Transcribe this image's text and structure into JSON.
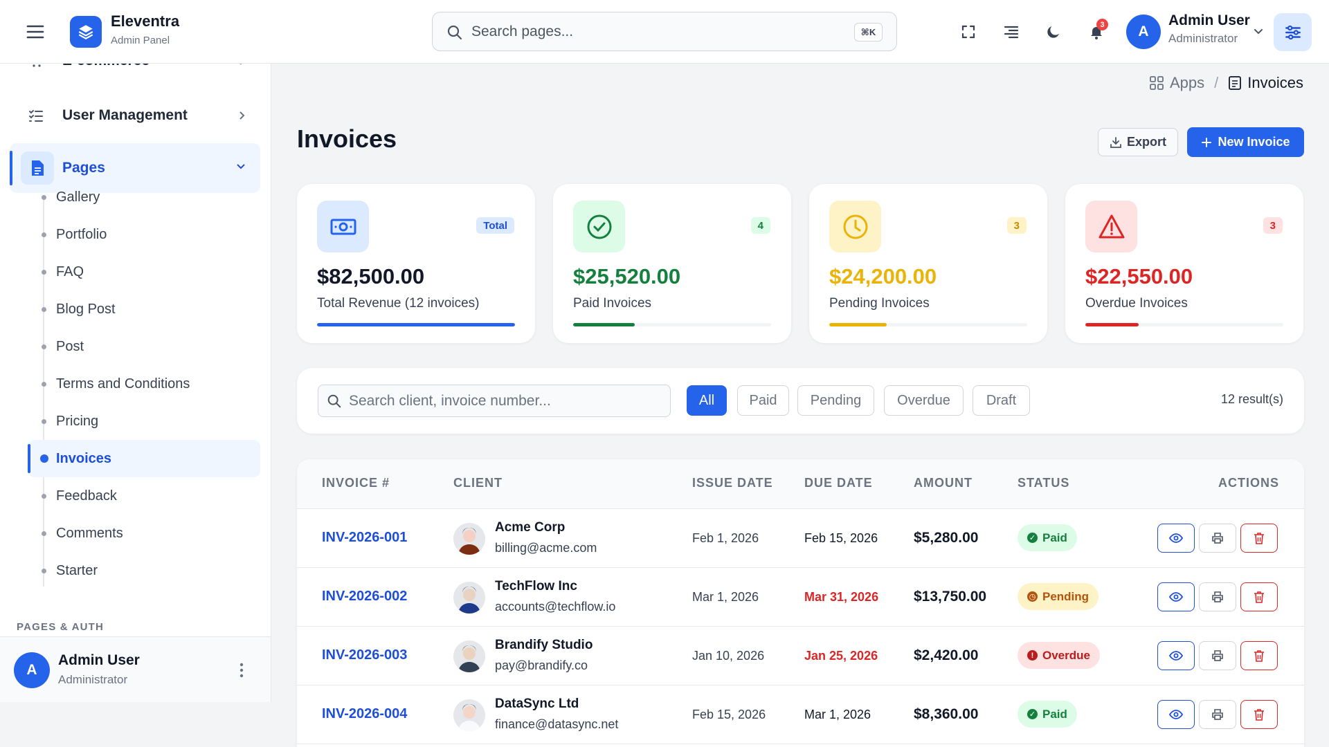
{
  "brand": {
    "name": "Eleventra",
    "subtitle": "Admin Panel"
  },
  "search": {
    "placeholder": "Search pages...",
    "shortcut": "⌘K"
  },
  "header": {
    "notification_count": "3",
    "user": {
      "initial": "A",
      "name": "Admin User",
      "role": "Administrator"
    }
  },
  "sidebar": {
    "ecommerce_label": "E-commerce",
    "user_management_label": "User Management",
    "pages_label": "Pages",
    "sub_items": [
      "Gallery",
      "Portfolio",
      "FAQ",
      "Blog Post",
      "Post",
      "Terms and Conditions",
      "Pricing",
      "Invoices",
      "Feedback",
      "Comments",
      "Starter"
    ],
    "active_sub_item": "Invoices",
    "section_label": "PAGES & AUTH",
    "footer": {
      "initial": "A",
      "name": "Admin User",
      "role": "Administrator"
    }
  },
  "breadcrumb": {
    "parent": "Apps",
    "separator": "/",
    "current": "Invoices"
  },
  "page": {
    "title": "Invoices",
    "export_label": "Export",
    "new_label": "New Invoice"
  },
  "stats": [
    {
      "badge": "Total",
      "value": "$82,500.00",
      "label": "Total Revenue (12 invoices)",
      "progress": 1.0,
      "color": "#2563eb"
    },
    {
      "badge": "4",
      "value": "$25,520.00",
      "label": "Paid Invoices",
      "progress": 0.31,
      "color": "#15803d"
    },
    {
      "badge": "3",
      "value": "$24,200.00",
      "label": "Pending Invoices",
      "progress": 0.29,
      "color": "#eab308"
    },
    {
      "badge": "3",
      "value": "$22,550.00",
      "label": "Overdue Invoices",
      "progress": 0.27,
      "color": "#dc2626"
    }
  ],
  "filters": {
    "search_placeholder": "Search client, invoice number...",
    "chips": [
      "All",
      "Paid",
      "Pending",
      "Overdue",
      "Draft"
    ],
    "active_chip": "All",
    "results": "12 result(s)"
  },
  "table": {
    "headers": [
      "INVOICE #",
      "CLIENT",
      "ISSUE DATE",
      "DUE DATE",
      "AMOUNT",
      "STATUS",
      "ACTIONS"
    ],
    "rows": [
      {
        "invoice": "INV-2026-001",
        "client": "Acme Corp",
        "email": "billing@acme.com",
        "issue": "Feb 1, 2026",
        "due": "Feb 15, 2026",
        "due_overdue": false,
        "amount": "$5,280.00",
        "status": "Paid"
      },
      {
        "invoice": "INV-2026-002",
        "client": "TechFlow Inc",
        "email": "accounts@techflow.io",
        "issue": "Mar 1, 2026",
        "due": "Mar 31, 2026",
        "due_overdue": true,
        "amount": "$13,750.00",
        "status": "Pending"
      },
      {
        "invoice": "INV-2026-003",
        "client": "Brandify Studio",
        "email": "pay@brandify.co",
        "issue": "Jan 10, 2026",
        "due": "Jan 25, 2026",
        "due_overdue": true,
        "amount": "$2,420.00",
        "status": "Overdue"
      },
      {
        "invoice": "INV-2026-004",
        "client": "DataSync Ltd",
        "email": "finance@datasync.net",
        "issue": "Feb 15, 2026",
        "due": "Mar 1, 2026",
        "due_overdue": false,
        "amount": "$8,360.00",
        "status": "Paid"
      }
    ]
  }
}
